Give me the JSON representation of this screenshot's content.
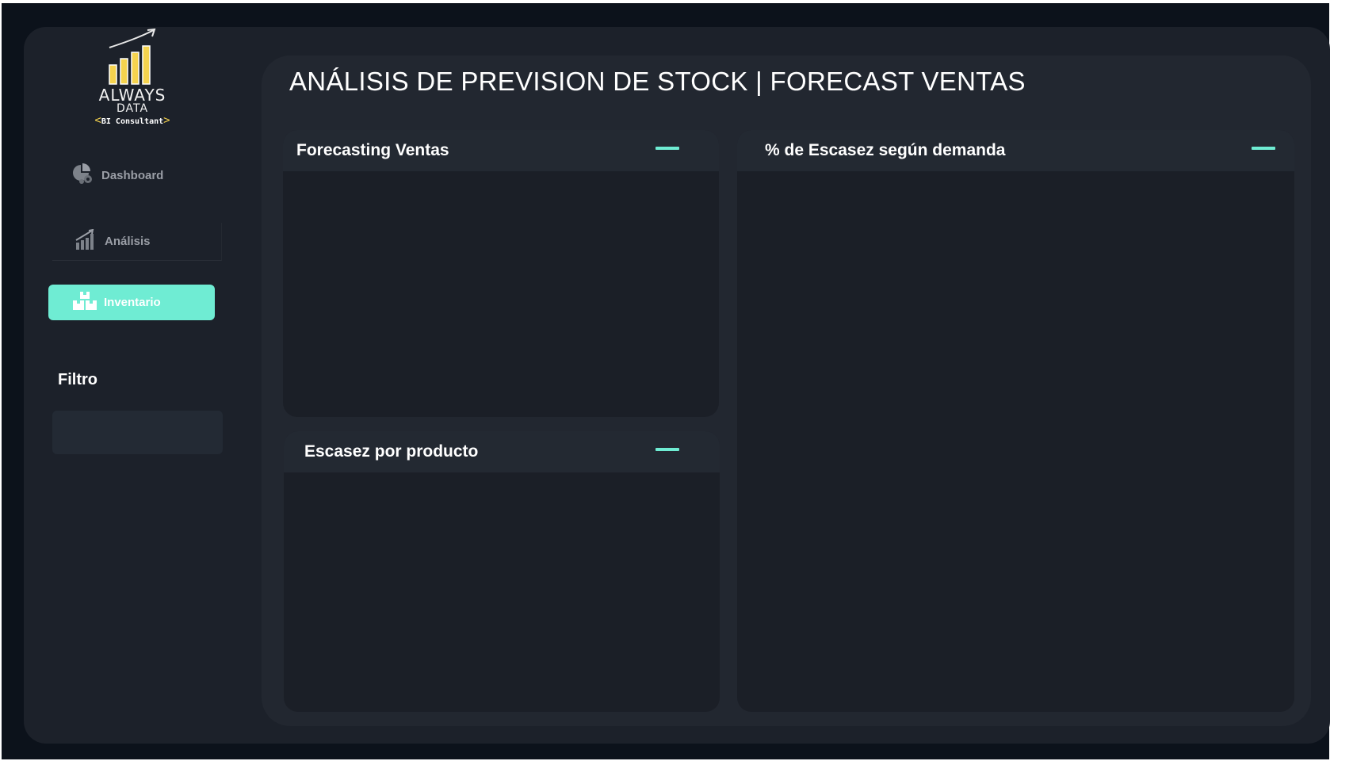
{
  "logo": {
    "word1": "ALWAYS",
    "word2": "DATA",
    "subtitle_left": "<",
    "subtitle": "BI Consultant",
    "subtitle_right": ">",
    "bar_color": "#f5d34e"
  },
  "nav": {
    "items": [
      {
        "label": "Dashboard",
        "icon": "pie-chart-gear-icon",
        "active": false
      },
      {
        "label": "Análisis",
        "icon": "bar-chart-growth-icon",
        "active": false
      },
      {
        "label": "Inventario",
        "icon": "boxes-icon",
        "active": true
      }
    ],
    "active_color": "#6fecd3"
  },
  "filter": {
    "title": "Filtro"
  },
  "page": {
    "title": "ANÁLISIS DE PREVISION DE STOCK | FORECAST VENTAS"
  },
  "cards": {
    "forecast": {
      "title": "Forecasting Ventas"
    },
    "escasez_producto": {
      "title": "Escasez por producto"
    },
    "escasez_demanda": {
      "title": "% de Escasez según demanda"
    }
  },
  "colors": {
    "background": "#1c212a",
    "panel": "#222730",
    "card": "#1b1f27",
    "accent": "#6fecd3"
  }
}
